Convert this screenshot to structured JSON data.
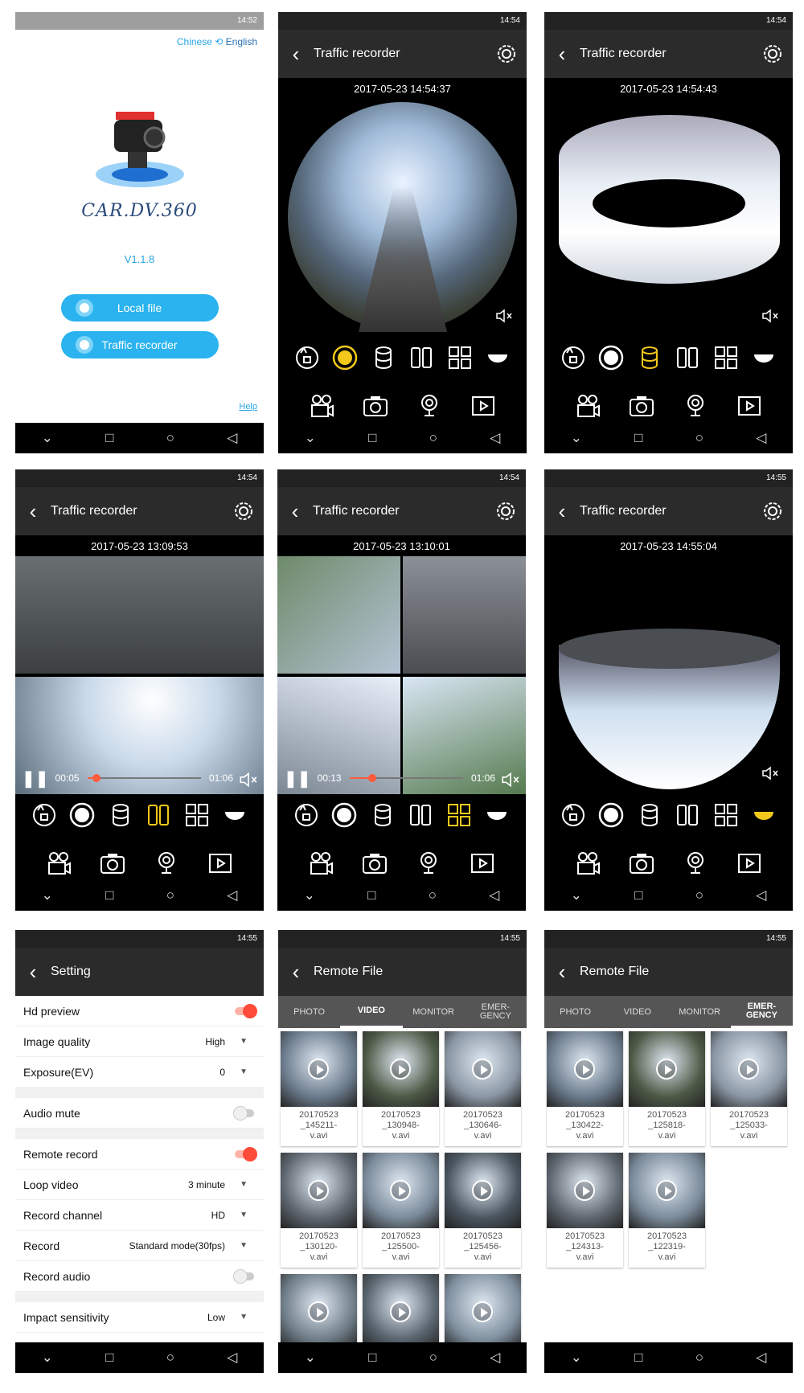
{
  "status_time": {
    "p1": "14:52",
    "p2": "14:54",
    "p3": "14:54",
    "p4": "14:54",
    "p5": "14:54",
    "p6": "14:55",
    "p7": "14:55",
    "p8": "14:55",
    "p9": "14:55"
  },
  "home": {
    "lang_chinese": "Chinese",
    "lang_english": "English",
    "brand": "CAR.DV.360",
    "version": "V1.1.8",
    "local_file": "Local file",
    "traffic_recorder": "Traffic recorder",
    "help": "Help"
  },
  "recorder": {
    "title": "Traffic recorder",
    "ts2": "2017-05-23 14:54:37",
    "ts3": "2017-05-23 14:54:43",
    "ts4": "2017-05-23 13:09:53",
    "ts5": "2017-05-23 13:10:01",
    "ts6": "2017-05-23 14:55:04",
    "p4_elapsed": "00:05",
    "p4_total": "01:06",
    "p4_progress": 0.08,
    "p5_elapsed": "00:13",
    "p5_total": "01:06",
    "p5_progress": 0.2
  },
  "setting": {
    "title": "Setting",
    "rows": [
      {
        "label": "Hd preview",
        "type": "toggle",
        "on": true
      },
      {
        "label": "Image quality",
        "value": "High"
      },
      {
        "label": "Exposure(EV)",
        "value": "0"
      },
      {
        "label": "Audio mute",
        "type": "toggle",
        "on": false
      },
      {
        "label": "Remote record",
        "type": "toggle",
        "on": true
      },
      {
        "label": "Loop video",
        "value": "3 minute"
      },
      {
        "label": "Record channel",
        "value": "HD"
      },
      {
        "label": "Record",
        "value": "Standard mode(30fps)"
      },
      {
        "label": "Record audio",
        "type": "toggle",
        "on": false
      },
      {
        "label": "Impact sensitivity",
        "value": "Low"
      }
    ]
  },
  "remote": {
    "title": "Remote File",
    "tabs": [
      "PHOTO",
      "VIDEO",
      "MONITOR",
      "EMER-\nGENCY"
    ],
    "video_files": [
      "20170523\n_145211-\nv.avi",
      "20170523\n_130948-\nv.avi",
      "20170523\n_130646-\nv.avi",
      "20170523\n_130120-\nv.avi",
      "20170523\n_125500-\nv.avi",
      "20170523\n_125456-\nv.avi",
      "",
      "",
      ""
    ],
    "emergency_files": [
      "20170523\n_130422-\nv.avi",
      "20170523\n_125818-\nv.avi",
      "20170523\n_125033-\nv.avi",
      "20170523\n_124313-\nv.avi",
      "20170523\n_122319-\nv.avi"
    ]
  }
}
